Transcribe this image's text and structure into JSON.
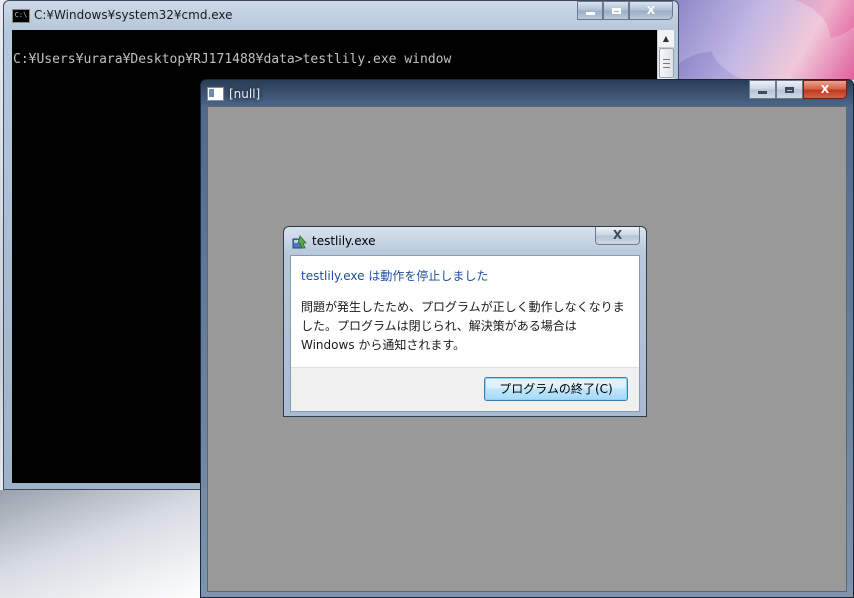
{
  "cmd_window": {
    "title": "C:¥Windows¥system32¥cmd.exe",
    "icon_text": "C:\\",
    "console_line": "C:¥Users¥urara¥Desktop¥RJ171488¥data>testlily.exe window",
    "close_glyph": "X",
    "icon": "cmd-icon"
  },
  "null_window": {
    "title": "[null]",
    "close_glyph": "X",
    "icon": "window-icon"
  },
  "error_dialog": {
    "title": "testlily.exe",
    "close_glyph": "X",
    "heading": "testlily.exe は動作を停止しました",
    "message": "問題が発生したため、プログラムが正しく動作しなくなりました。プログラムは閉じられ、解決策がある場合は Windows から通知されます。",
    "button_label": "プログラムの終了(C)",
    "icon": "program-error-icon"
  },
  "colors": {
    "console_bg": "#000000",
    "console_text": "#c0c0c0",
    "null_client_bg": "#999999",
    "heading_blue": "#1c4f9a",
    "close_red": "#c2391f"
  }
}
